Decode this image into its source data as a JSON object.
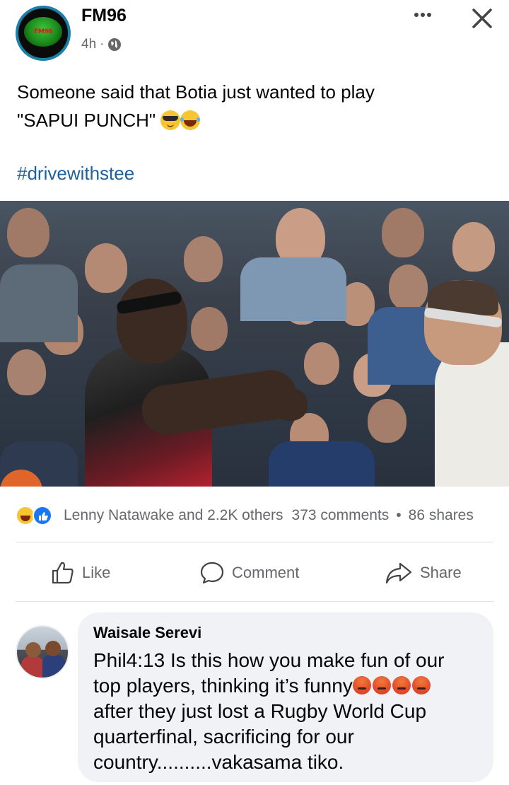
{
  "post": {
    "page_name": "FM96",
    "time": "4h",
    "avatar_label": "FM96",
    "text_line1": "Someone said that Botia just wanted to play",
    "text_line2": "\"SAPUI PUNCH\"",
    "emojis": [
      "smiling-face-with-sunglasses",
      "face-with-tears-of-joy"
    ],
    "hashtag": "#drivewithstee"
  },
  "stats": {
    "reactions": "Lenny Natawake and 2.2K others",
    "comments": "373 comments",
    "separator": "•",
    "shares": "86 shares"
  },
  "actions": {
    "like": "Like",
    "comment": "Comment",
    "share": "Share"
  },
  "comment": {
    "author": "Waisale Serevi",
    "line1": "Phil4:13 Is this how you make fun of our",
    "line2": "top players, thinking it’s funny",
    "line3": "after they just lost a Rugby World Cup",
    "line4": "quarterfinal, sacrificing for our",
    "line5": "country..........vakasama tiko.",
    "emoji_count": 4
  },
  "colors": {
    "secondary_text": "#65676b",
    "hashtag": "#1f5f9a",
    "like_blue": "#1877f2",
    "bubble": "#f0f2f5"
  },
  "icons": {
    "more": "more-horizontal-icon",
    "close": "close-icon",
    "privacy": "globe-icon",
    "like": "thumbs-up-icon",
    "comment": "comment-bubble-icon",
    "share": "share-arrow-icon"
  }
}
